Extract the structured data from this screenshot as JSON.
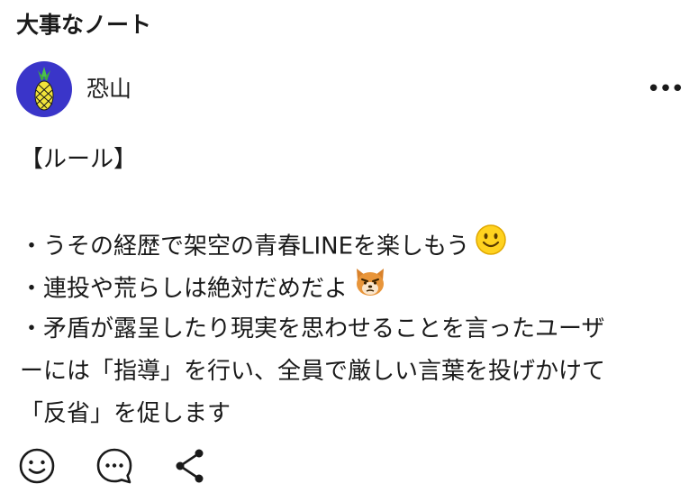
{
  "header": {
    "title": "大事なノート"
  },
  "author": {
    "name": "恐山",
    "avatar_icon": "pineapple-icon"
  },
  "menu": {
    "icon": "more-horizontal-icon",
    "label": "•••"
  },
  "note": {
    "lines": [
      "【ルール】",
      "・うその経歴で架空の青春LINEを楽しもう",
      "・連投や荒らしは絶対だめだよ",
      "・矛盾が露呈したり現実を思わせることを言ったユーザ",
      "ーには「指導」を行い、全員で厳しい言葉を投げかけて",
      "「反省」を促します"
    ],
    "emojis": [
      "smiling-face-icon",
      "grumpy-dog-face-icon"
    ]
  },
  "actions": [
    "smiley-reaction-icon",
    "comment-icon",
    "share-icon"
  ],
  "colors": {
    "avatar_bg": "#3a35c9",
    "pineapple": "#f2e43a",
    "text": "#1a1a1a"
  }
}
